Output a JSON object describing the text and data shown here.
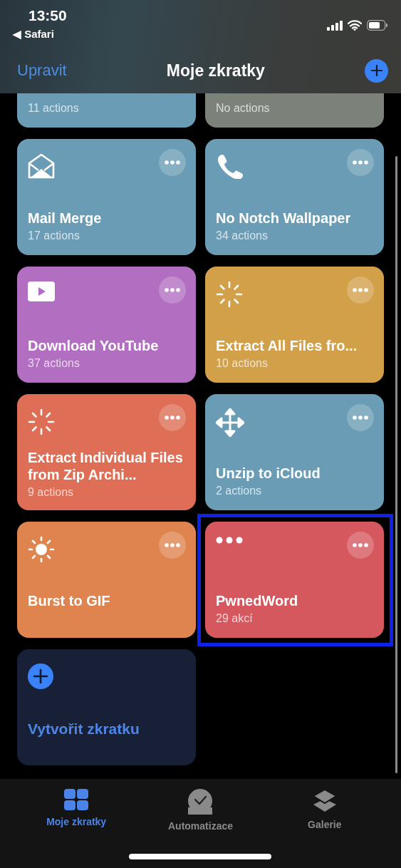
{
  "status_bar": {
    "time": "13:50",
    "back_label": "◀ Safari"
  },
  "nav_bar": {
    "edit": "Upravit",
    "title": "Moje zkratky"
  },
  "partial_cards": [
    {
      "subtitle": "11 actions",
      "color": "#6a9db5"
    },
    {
      "subtitle": "No actions",
      "color": "#7c817a"
    }
  ],
  "cards": [
    {
      "kind": "shortcut",
      "title": "Mail Merge",
      "subtitle": "17 actions",
      "color": "#6a9db5",
      "highlighted": false
    },
    {
      "kind": "shortcut",
      "title": "No Notch Wallpaper",
      "subtitle": "34 actions",
      "color": "#6a9db5",
      "highlighted": false
    },
    {
      "kind": "shortcut",
      "title": "Download YouTube",
      "subtitle": "37 actions",
      "color": "#b26fc2",
      "highlighted": false
    },
    {
      "kind": "shortcut",
      "title": "Extract All Files fro...",
      "subtitle": "10 actions",
      "color": "#d3a04a",
      "highlighted": false
    },
    {
      "kind": "shortcut",
      "title": "Extract Individual Files from Zip Archi...",
      "subtitle": "9 actions",
      "color": "#de6e55",
      "highlighted": false
    },
    {
      "kind": "shortcut",
      "title": "Unzip to iCloud",
      "subtitle": "2 actions",
      "color": "#6a9db5",
      "highlighted": false
    },
    {
      "kind": "shortcut",
      "title": "Burst to GIF",
      "color": "#e0844f",
      "highlighted": false
    },
    {
      "kind": "shortcut",
      "title": "PwnedWord",
      "subtitle": "29 akcí",
      "color": "#d5585f",
      "highlighted": true
    },
    {
      "kind": "create",
      "title": "Vytvořit zkratku"
    }
  ],
  "tab_bar": [
    {
      "label": "Moje zkratky",
      "selected": true
    },
    {
      "label": "Automatizace",
      "selected": false
    },
    {
      "label": "Galerie",
      "selected": false
    }
  ]
}
